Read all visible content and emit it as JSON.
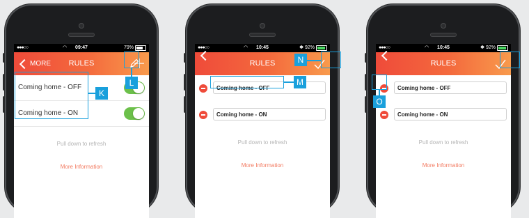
{
  "phones": [
    {
      "status": {
        "signal": "●●●○○",
        "time": "09:47",
        "battery": "79%"
      },
      "nav": {
        "back_label": "MORE",
        "title": "RULES"
      },
      "rules": [
        {
          "label": "Coming home - OFF",
          "enabled": true
        },
        {
          "label": "Coming home - ON",
          "enabled": true
        }
      ],
      "callouts": [
        "K",
        "L"
      ]
    },
    {
      "status": {
        "signal": "●●●○○",
        "time": "10:45",
        "battery": "92%"
      },
      "nav": {
        "title": "RULES"
      },
      "rules": [
        {
          "label": "Coming home - OFF"
        },
        {
          "label": "Coming home - ON"
        }
      ],
      "callouts": [
        "N",
        "M"
      ]
    },
    {
      "status": {
        "signal": "●●●○○",
        "time": "10:45",
        "battery": "92%"
      },
      "nav": {
        "title": "RULES"
      },
      "rules": [
        {
          "label": "Coming home - OFF"
        },
        {
          "label": "Coming home - ON"
        }
      ],
      "callouts": [
        "O"
      ]
    }
  ],
  "footer": {
    "pull_text": "Pull down to refresh",
    "more_info": "More Information"
  },
  "colors": {
    "accent": "#ef4b3a",
    "toggle_on": "#6cc04a",
    "callout": "#1aa0dc"
  }
}
